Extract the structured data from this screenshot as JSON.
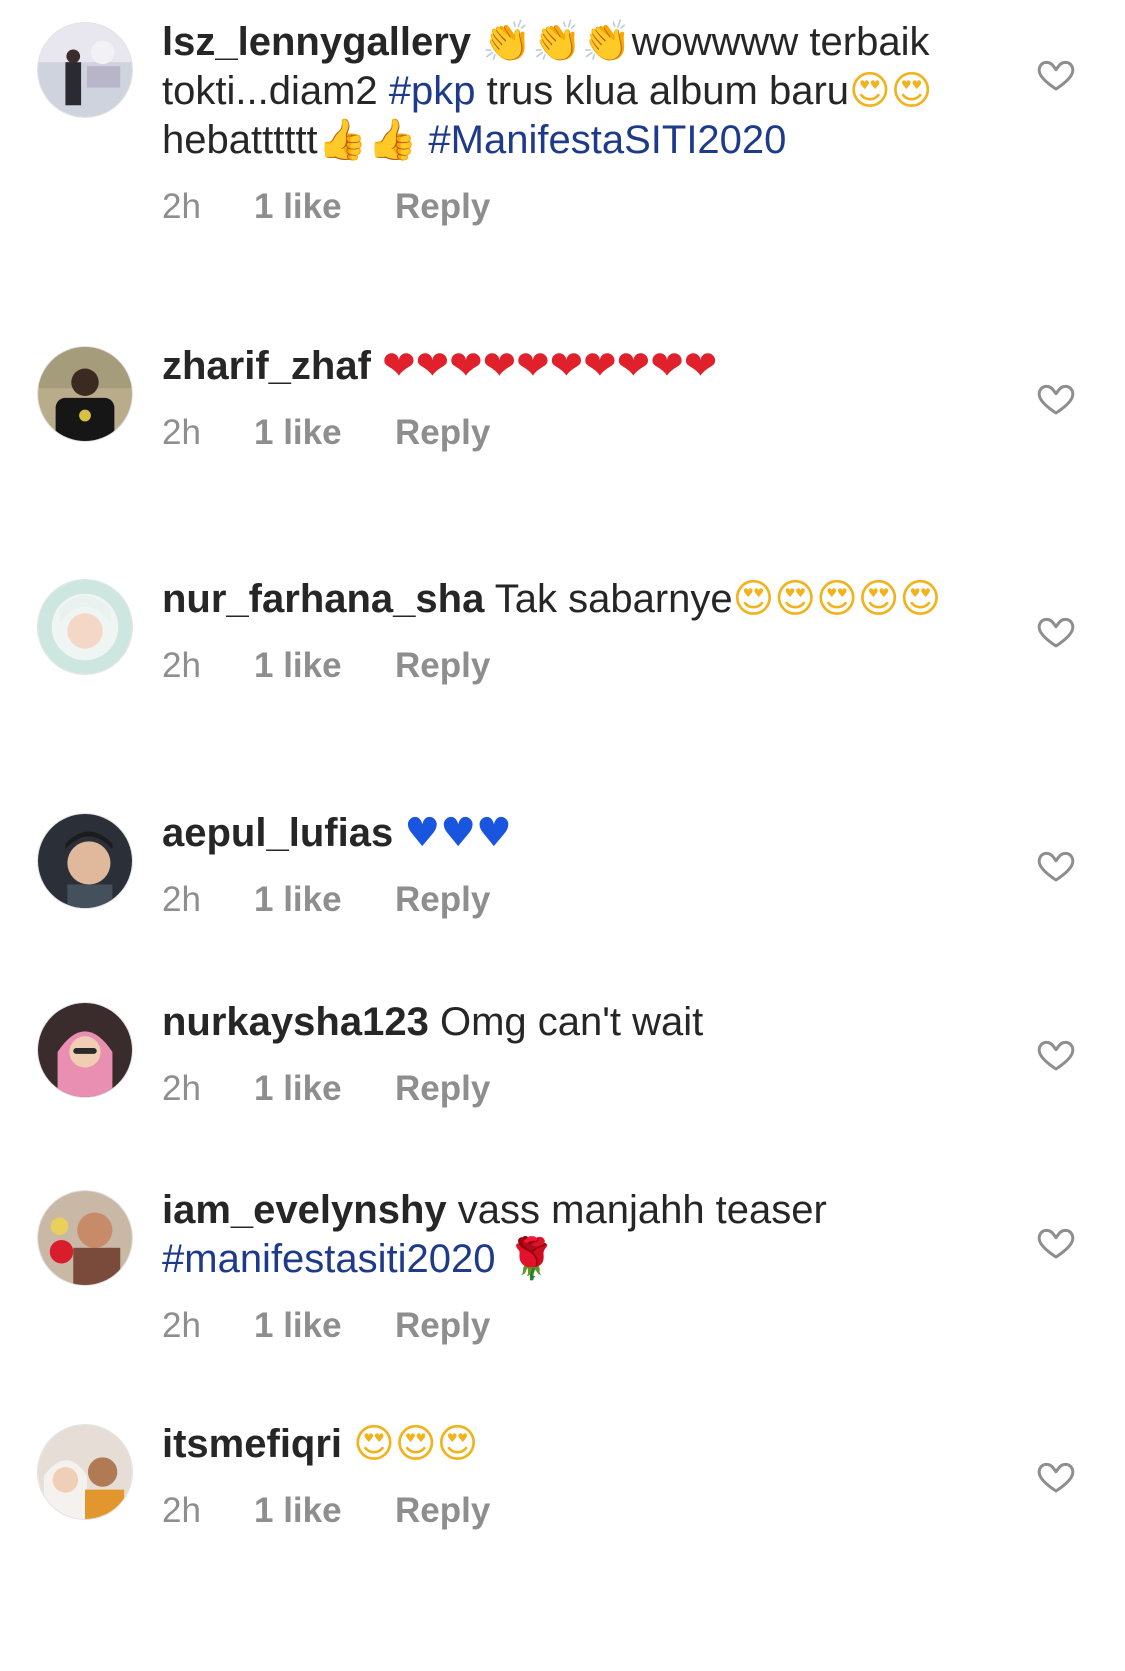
{
  "comments": [
    {
      "username": "lsz_lennygallery",
      "segments": [
        {
          "type": "emoji",
          "value": "👏",
          "style": "hand"
        },
        {
          "type": "emoji",
          "value": "👏",
          "style": "hand"
        },
        {
          "type": "emoji",
          "value": "👏",
          "style": "hand"
        },
        {
          "type": "text",
          "value": "wowwww terbaik tokti...diam2 "
        },
        {
          "type": "hashtag",
          "value": "#pkp"
        },
        {
          "type": "text",
          "value": " trus klua album baru"
        },
        {
          "type": "emoji",
          "value": "😍",
          "style": "face"
        },
        {
          "type": "emoji",
          "value": "😍",
          "style": "face"
        },
        {
          "type": "text",
          "value": "hebatttttt"
        },
        {
          "type": "emoji",
          "value": "👍",
          "style": "hand"
        },
        {
          "type": "emoji",
          "value": "👍",
          "style": "hand"
        },
        {
          "type": "text",
          "value": " "
        },
        {
          "type": "hashtag",
          "value": "#ManifestaSITI2020"
        }
      ],
      "time": "2h",
      "likes": "1 like",
      "reply": "Reply"
    },
    {
      "username": "zharif_zhaf",
      "segments": [
        {
          "type": "emoji",
          "value": "❤",
          "style": "red"
        },
        {
          "type": "emoji",
          "value": "❤",
          "style": "red"
        },
        {
          "type": "emoji",
          "value": "❤",
          "style": "red"
        },
        {
          "type": "emoji",
          "value": "❤",
          "style": "red"
        },
        {
          "type": "emoji",
          "value": "❤",
          "style": "red"
        },
        {
          "type": "emoji",
          "value": "❤",
          "style": "red"
        },
        {
          "type": "emoji",
          "value": "❤",
          "style": "red"
        },
        {
          "type": "emoji",
          "value": "❤",
          "style": "red"
        },
        {
          "type": "emoji",
          "value": "❤",
          "style": "red"
        },
        {
          "type": "emoji",
          "value": "❤",
          "style": "red"
        }
      ],
      "time": "2h",
      "likes": "1 like",
      "reply": "Reply"
    },
    {
      "username": "nur_farhana_sha",
      "segments": [
        {
          "type": "text",
          "value": "Tak sabarnye"
        },
        {
          "type": "emoji",
          "value": "😍",
          "style": "face"
        },
        {
          "type": "emoji",
          "value": "😍",
          "style": "face"
        },
        {
          "type": "emoji",
          "value": "😍",
          "style": "face"
        },
        {
          "type": "emoji",
          "value": "😍",
          "style": "face"
        },
        {
          "type": "emoji",
          "value": "😍",
          "style": "face"
        }
      ],
      "time": "2h",
      "likes": "1 like",
      "reply": "Reply"
    },
    {
      "username": "aepul_lufias",
      "segments": [
        {
          "type": "emoji",
          "value": "♥",
          "style": "blue"
        },
        {
          "type": "emoji",
          "value": "♥",
          "style": "blue"
        },
        {
          "type": "emoji",
          "value": "♥",
          "style": "blue"
        }
      ],
      "time": "2h",
      "likes": "1 like",
      "reply": "Reply"
    },
    {
      "username": "nurkaysha123",
      "segments": [
        {
          "type": "text",
          "value": "Omg can't wait"
        }
      ],
      "time": "2h",
      "likes": "1 like",
      "reply": "Reply"
    },
    {
      "username": "iam_evelynshy",
      "segments": [
        {
          "type": "text",
          "value": "vass manjahh teaser "
        },
        {
          "type": "hashtag",
          "value": "#manifestasiti2020"
        },
        {
          "type": "text",
          "value": " "
        },
        {
          "type": "emoji",
          "value": "🌹",
          "style": "rose"
        }
      ],
      "time": "2h",
      "likes": "1 like",
      "reply": "Reply"
    },
    {
      "username": "itsmefiqri",
      "segments": [
        {
          "type": "emoji",
          "value": "😍",
          "style": "face"
        },
        {
          "type": "emoji",
          "value": "😍",
          "style": "face"
        },
        {
          "type": "emoji",
          "value": "😍",
          "style": "face"
        }
      ],
      "time": "2h",
      "likes": "1 like",
      "reply": "Reply"
    }
  ],
  "colors": {
    "text": "#262626",
    "meta": "#8e8e8e",
    "hashtag": "#1e3a8a",
    "heart_outline": "#8e8e8e"
  },
  "icons": {
    "like": "heart-outline-icon"
  }
}
